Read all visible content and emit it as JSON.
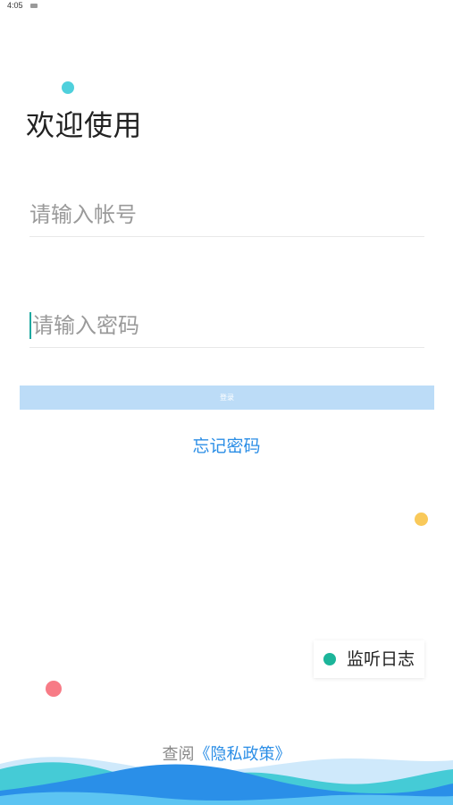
{
  "status_bar": {
    "time": "4:05"
  },
  "colors": {
    "accent": "#2b8ee6",
    "button_bg": "#bcdcf7",
    "dot_teal": "#4fd0dc",
    "dot_yellow": "#f9c95a",
    "dot_red": "#f77b86",
    "monitor_dot": "#1cb59a",
    "cursor": "#1fa8a0"
  },
  "header": {
    "title": "欢迎使用"
  },
  "form": {
    "account_placeholder": "请输入帐号",
    "password_placeholder": "请输入密码",
    "login_label": "登录",
    "forgot_label": "忘记密码"
  },
  "monitor": {
    "label": "监听日志"
  },
  "footer": {
    "privacy_prefix": "查阅",
    "privacy_link": "《隐私政策》"
  }
}
